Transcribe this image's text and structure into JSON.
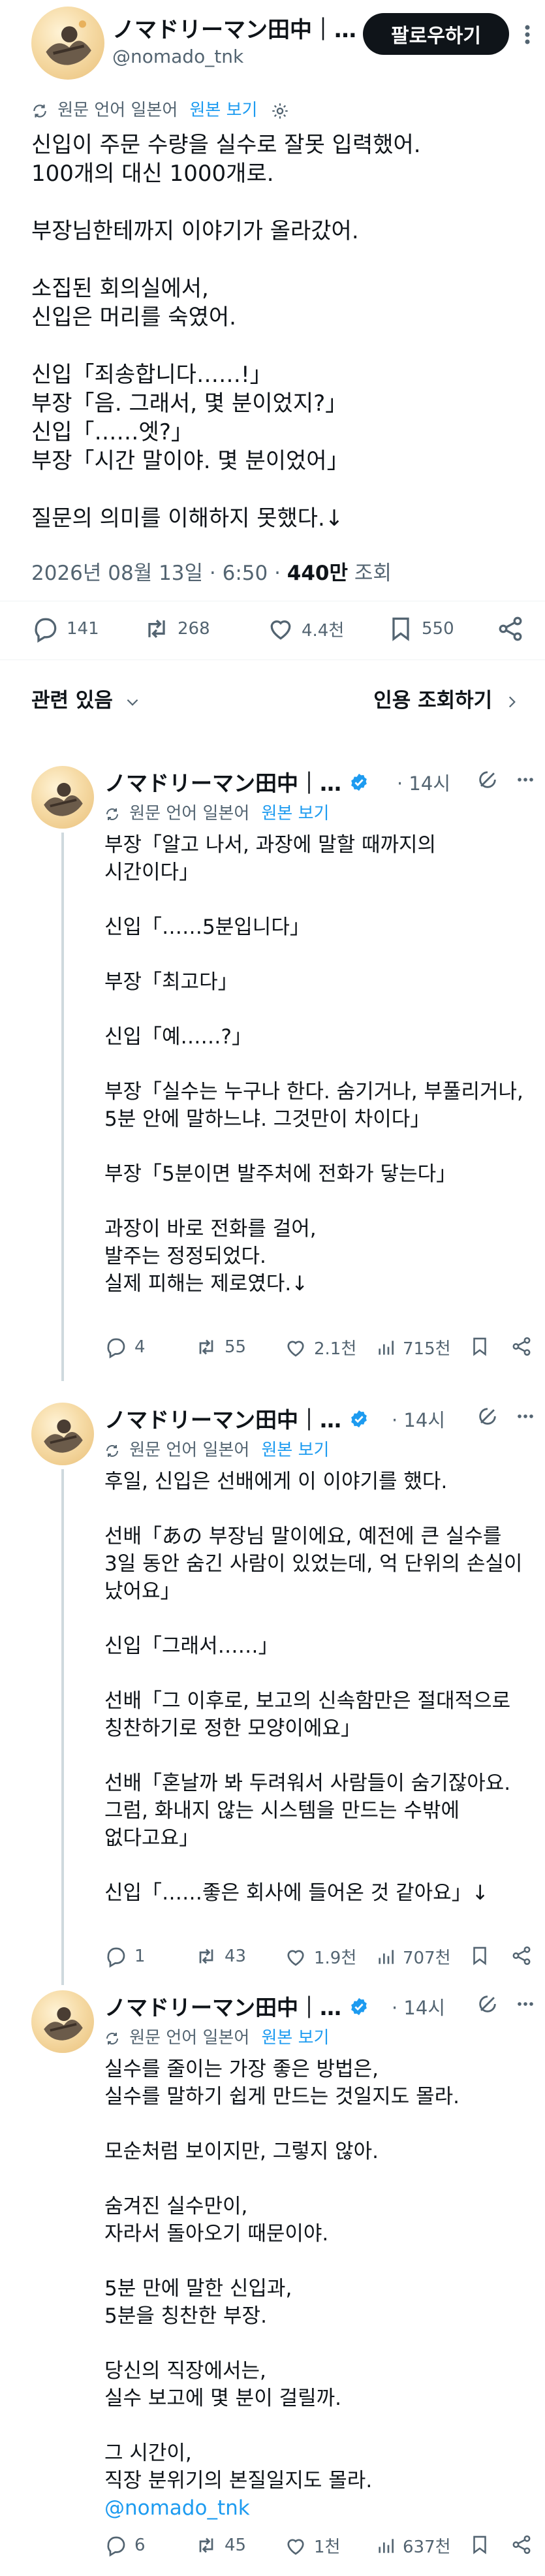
{
  "author": {
    "name": "ノマドリーマン田中｜…",
    "handle": "@nomado_tnk"
  },
  "follow_button": "팔로우하기",
  "translate": {
    "label": "원문 언어 일본어",
    "link": "원본 보기"
  },
  "main_tweet": {
    "text": "신입이 주문 수량을 실수로 잘못 입력했어.\n100개의 대신 1000개로.\n\n부장님한테까지 이야기가 올라갔어.\n\n소집된 회의실에서,\n신입은 머리를 숙였어.\n\n신입「죄송합니다……!」\n부장「음. 그래서, 몇 분이었지?」\n신입「……엣?」\n부장「시간 말이야. 몇 분이었어」\n\n질문의 의미를 이해하지 못했다.↓",
    "date": "2026년 08월 13일 · 6:50 · ",
    "views": "440만",
    "views_label": " 조회",
    "replies": "141",
    "retweets": "268",
    "likes": "4.4천",
    "bookmarks": "550"
  },
  "related": {
    "left_label": "관련 있음",
    "right_label": "인용 조회하기"
  },
  "replies": [
    {
      "time": "· 14시",
      "text": "부장「알고 나서, 과장에 말할 때까지의\n시간이다」\n\n신입「……5분입니다」\n\n부장「최고다」\n\n신입「예……?」\n\n부장「실수는 누구나 한다. 숨기거나, 부풀리거나,\n5분 안에 말하느냐. 그것만이 차이다」\n\n부장「5분이면 발주처에 전화가 닿는다」\n\n과장이 바로 전화를 걸어,\n발주는 정정되었다.\n실제 피해는 제로였다.↓",
      "mention": "",
      "replies": "4",
      "retweets": "55",
      "likes": "2.1천",
      "views": "715천"
    },
    {
      "time": "· 14시",
      "text": "후일, 신입은 선배에게 이 이야기를 했다.\n\n선배「あの 부장님 말이에요, 예전에 큰 실수를\n3일 동안 숨긴 사람이 있었는데, 억 단위의 손실이\n났어요」\n\n신입「그래서……」\n\n선배「그 이후로, 보고의 신속함만은 절대적으로\n칭찬하기로 정한 모양이에요」\n\n선배「혼날까 봐 두려워서 사람들이 숨기잖아요.\n그럼, 화내지 않는 시스템을 만드는 수밖에\n없다고요」\n\n신입「……좋은 회사에 들어온 것 같아요」↓",
      "mention": "",
      "replies": "1",
      "retweets": "43",
      "likes": "1.9천",
      "views": "707천"
    },
    {
      "time": "· 14시",
      "text": "실수를 줄이는 가장 좋은 방법은,\n실수를 말하기 쉽게 만드는 것일지도 몰라.\n\n모순처럼 보이지만, 그렇지 않아.\n\n숨겨진 실수만이,\n자라서 돌아오기 때문이야.\n\n5분 만에 말한 신입과,\n5분을 칭찬한 부장.\n\n당신의 직장에서는,\n실수 보고에 몇 분이 걸릴까.\n\n그 시간이,\n직장 분위기의 본질일지도 몰라.",
      "mention": "@nomado_tnk",
      "replies": "6",
      "retweets": "45",
      "likes": "1천",
      "views": "637천"
    }
  ],
  "icons": [
    "verified-badge-icon",
    "translate-icon",
    "settings-icon",
    "reply-icon",
    "retweet-icon",
    "like-icon",
    "bookmark-icon",
    "share-icon",
    "views-icon",
    "grok-icon",
    "more-icon",
    "chevron-down-icon",
    "chevron-right-icon"
  ],
  "colors": {
    "accent": "#1d9bf0",
    "text": "#0f1419",
    "muted": "#536471",
    "thread_line": "#cfd9de"
  }
}
